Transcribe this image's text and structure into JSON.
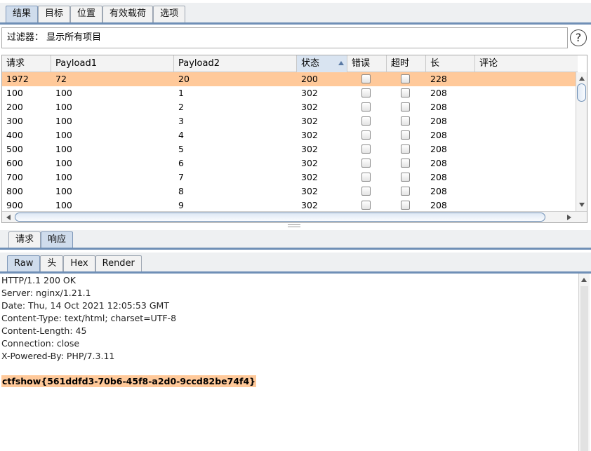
{
  "top_tabs": [
    {
      "label": "结果",
      "active": true
    },
    {
      "label": "目标",
      "active": false
    },
    {
      "label": "位置",
      "active": false
    },
    {
      "label": "有效载荷",
      "active": false
    },
    {
      "label": "选项",
      "active": false
    }
  ],
  "filter": {
    "text": "过滤器： 显示所有项目",
    "help_icon": "?"
  },
  "table": {
    "columns": [
      "请求",
      "Payload1",
      "Payload2",
      "状态",
      "错误",
      "超时",
      "长",
      "评论"
    ],
    "sorted_column": "状态",
    "rows": [
      {
        "req": "1972",
        "p1": "72",
        "p2": "20",
        "status": "200",
        "error": false,
        "timeout": false,
        "length": "228",
        "comment": "",
        "selected": true
      },
      {
        "req": "100",
        "p1": "100",
        "p2": "1",
        "status": "302",
        "error": false,
        "timeout": false,
        "length": "208",
        "comment": ""
      },
      {
        "req": "200",
        "p1": "100",
        "p2": "2",
        "status": "302",
        "error": false,
        "timeout": false,
        "length": "208",
        "comment": ""
      },
      {
        "req": "300",
        "p1": "100",
        "p2": "3",
        "status": "302",
        "error": false,
        "timeout": false,
        "length": "208",
        "comment": ""
      },
      {
        "req": "400",
        "p1": "100",
        "p2": "4",
        "status": "302",
        "error": false,
        "timeout": false,
        "length": "208",
        "comment": ""
      },
      {
        "req": "500",
        "p1": "100",
        "p2": "5",
        "status": "302",
        "error": false,
        "timeout": false,
        "length": "208",
        "comment": ""
      },
      {
        "req": "600",
        "p1": "100",
        "p2": "6",
        "status": "302",
        "error": false,
        "timeout": false,
        "length": "208",
        "comment": ""
      },
      {
        "req": "700",
        "p1": "100",
        "p2": "7",
        "status": "302",
        "error": false,
        "timeout": false,
        "length": "208",
        "comment": ""
      },
      {
        "req": "800",
        "p1": "100",
        "p2": "8",
        "status": "302",
        "error": false,
        "timeout": false,
        "length": "208",
        "comment": ""
      },
      {
        "req": "900",
        "p1": "100",
        "p2": "9",
        "status": "302",
        "error": false,
        "timeout": false,
        "length": "208",
        "comment": ""
      }
    ]
  },
  "message_tabs": [
    {
      "label": "请求",
      "active": false
    },
    {
      "label": "响应",
      "active": true
    }
  ],
  "view_tabs": [
    {
      "label": "Raw",
      "active": true
    },
    {
      "label": "头",
      "active": false
    },
    {
      "label": "Hex",
      "active": false
    },
    {
      "label": "Render",
      "active": false
    }
  ],
  "response": {
    "headers": [
      "HTTP/1.1 200 OK",
      "Server: nginx/1.21.1",
      "Date: Thu, 14 Oct 2021 12:05:53 GMT",
      "Content-Type: text/html; charset=UTF-8",
      "Content-Length: 45",
      "Connection: close",
      "X-Powered-By: PHP/7.3.11"
    ],
    "body": "ctfshow{561ddfd3-70b6-45f8-a2d0-9ccd82be74f4}"
  },
  "colors": {
    "selected_row": "#ffc99a",
    "tab_active": "#cfdcec",
    "accent_line": "#6f8fb6"
  }
}
